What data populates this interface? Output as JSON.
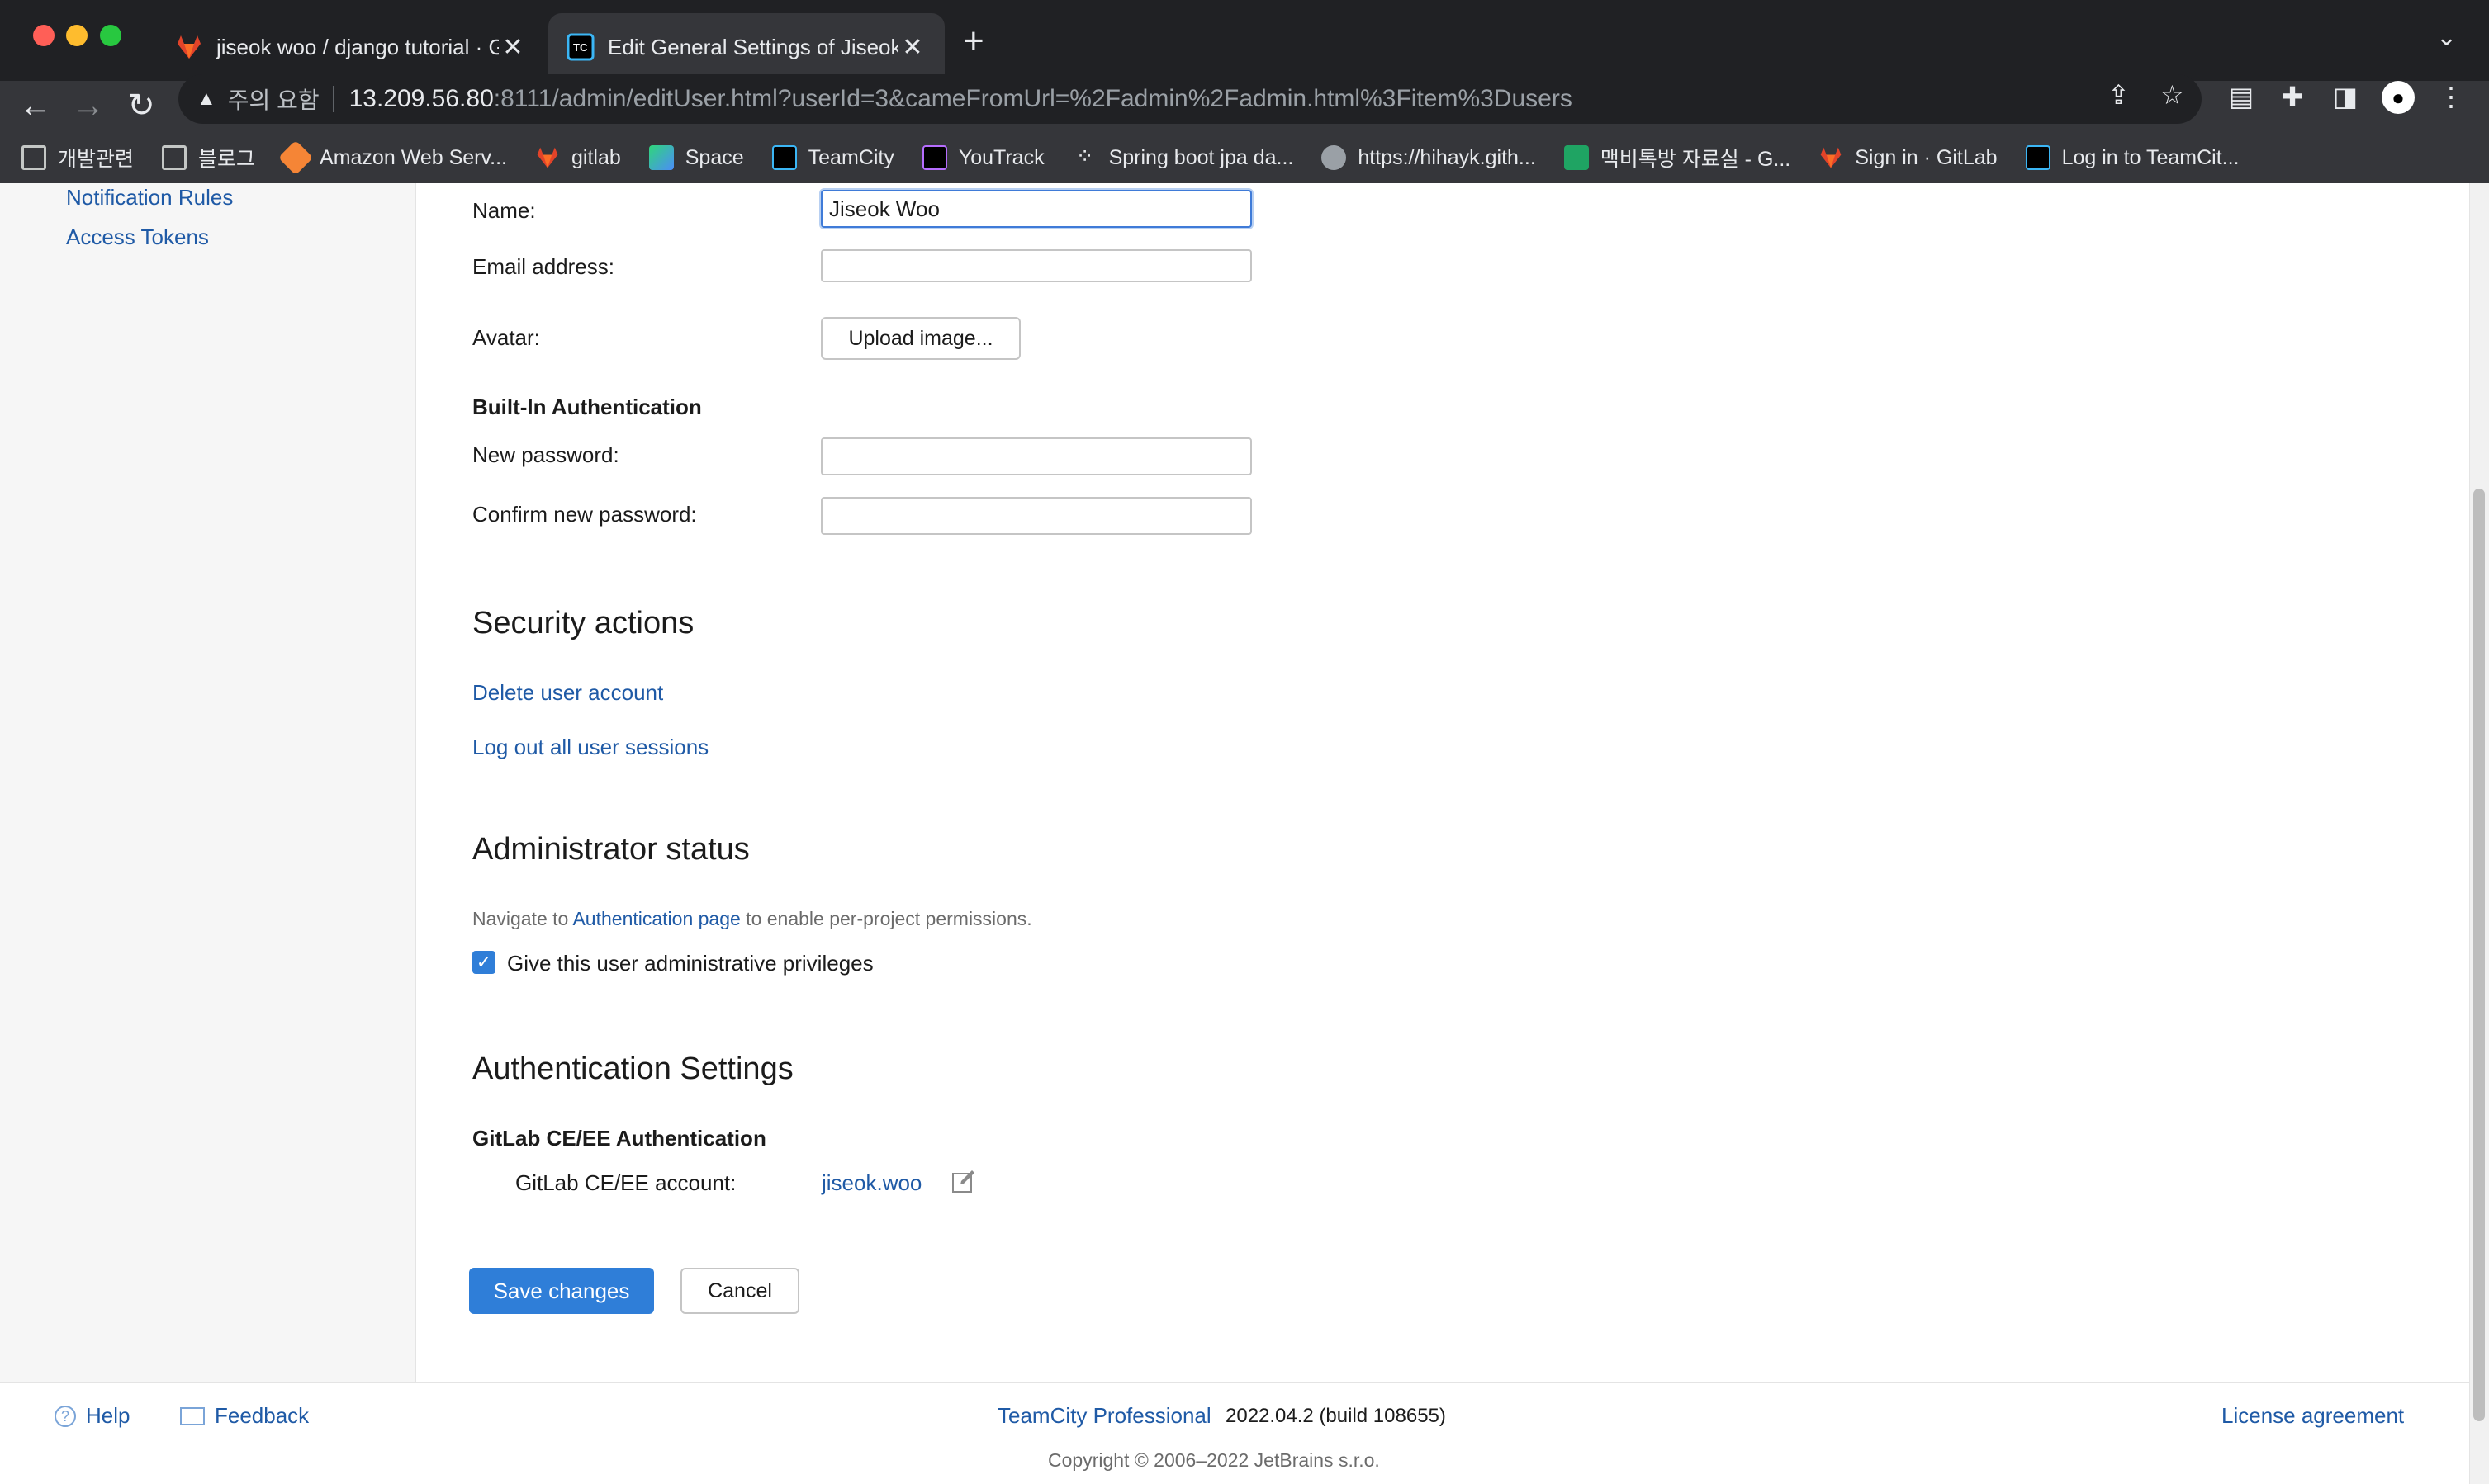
{
  "browser": {
    "tabs": [
      {
        "title": "jiseok woo / django tutorial · Gi",
        "active": false
      },
      {
        "title": "Edit General Settings of Jiseok",
        "active": true
      }
    ],
    "address": {
      "security_label": "주의 요함",
      "host": "13.209.56.80",
      "rest": ":8111/admin/editUser.html?userId=3&cameFromUrl=%2Fadmin%2Fadmin.html%3Fitem%3Dusers"
    },
    "bookmarks": [
      {
        "label": "개발관련",
        "icon": "folder-icon"
      },
      {
        "label": "블로그",
        "icon": "folder-icon"
      },
      {
        "label": "Amazon Web Serv...",
        "icon": "aws-icon"
      },
      {
        "label": "gitlab",
        "icon": "gitlab-icon"
      },
      {
        "label": "Space",
        "icon": "space-icon"
      },
      {
        "label": "TeamCity",
        "icon": "teamcity-icon"
      },
      {
        "label": "YouTrack",
        "icon": "youtrack-icon"
      },
      {
        "label": "Spring boot jpa da...",
        "icon": "dots-icon"
      },
      {
        "label": "https://hihayk.gith...",
        "icon": "globe-icon"
      },
      {
        "label": "맥비톡방 자료실 - G...",
        "icon": "sheets-icon"
      },
      {
        "label": "Sign in · GitLab",
        "icon": "gitlab-icon"
      },
      {
        "label": "Log in to TeamCit...",
        "icon": "teamcity-icon"
      }
    ]
  },
  "sidebar": {
    "items": [
      "Notification Rules",
      "Access Tokens"
    ]
  },
  "form": {
    "name_label": "Name:",
    "name_value": "Jiseok Woo",
    "email_label": "Email address:",
    "email_value": "",
    "avatar_label": "Avatar:",
    "upload_button": "Upload image...",
    "builtin_heading": "Built-In Authentication",
    "new_password_label": "New password:",
    "confirm_password_label": "Confirm new password:"
  },
  "security": {
    "heading": "Security actions",
    "delete_link": "Delete user account",
    "logout_link": "Log out all user sessions"
  },
  "admin": {
    "heading": "Administrator status",
    "note_prefix": "Navigate to ",
    "note_link": "Authentication page",
    "note_suffix": " to enable per-project permissions.",
    "checkbox_label": "Give this user administrative privileges",
    "checked": true
  },
  "auth": {
    "heading": "Authentication Settings",
    "subheading": "GitLab CE/EE Authentication",
    "account_label": "GitLab CE/EE account:",
    "account_value": "jiseok.woo"
  },
  "actions": {
    "save": "Save changes",
    "cancel": "Cancel"
  },
  "footer": {
    "help": "Help",
    "feedback": "Feedback",
    "product_link": "TeamCity Professional",
    "version": "2022.04.2 (build 108655)",
    "license": "License agreement",
    "copyright": "Copyright © 2006–2022 JetBrains s.r.o."
  },
  "colors": {
    "link": "#1f5aa6",
    "primary": "#2f7ed8",
    "chrome_dark": "#202124"
  }
}
